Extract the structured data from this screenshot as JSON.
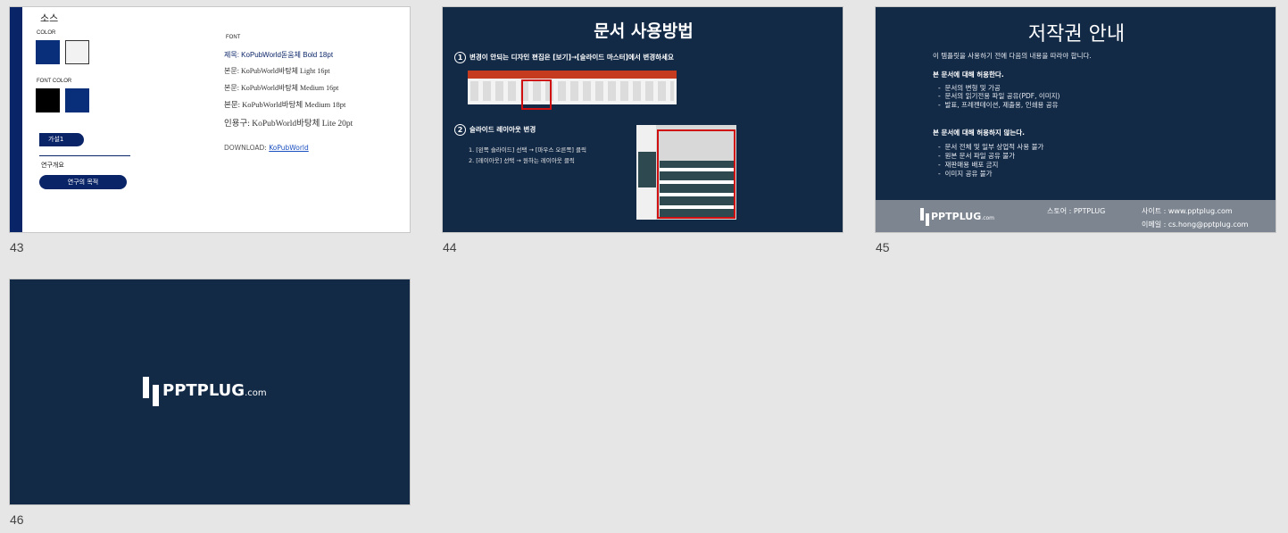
{
  "slides": [
    {
      "number": "43",
      "title": "소스",
      "color_label": "COLOR",
      "font_color_label": "FONT COLOR",
      "font_label": "FONT",
      "swatches": {
        "navy": "#0a2f7a",
        "light": "#f2f2f2",
        "black": "#000000"
      },
      "font_lines": [
        "제목: KoPubWorld돋움체 Bold 18pt",
        "본문: KoPubWorld바탕체 Light 16pt",
        "본문: KoPubWorld바탕체 Medium 16pt",
        "본문: KoPubWorld바탕체 Medium 18pt",
        "인용구: KoPubWorld바탕체 Lite 20pt"
      ],
      "download_label": "DOWNLOAD:",
      "download_link": "KoPubWorld",
      "pill_hypothesis": "가설1",
      "research_overview": "연구개요",
      "research_purpose": "연구의 목적"
    },
    {
      "number": "44",
      "title": "문서 사용방법",
      "step1_num": "1",
      "step1": "변경이 안되는 디자인 편집은 [보기]→[슬라이드 마스터]에서 변경하세요",
      "step2_num": "2",
      "step2": "슬라이드 레이아웃 변경",
      "sub1": "1. [왼쪽 슬라이드] 선택 → [마우스 오른쪽] 클릭",
      "sub2": "2. [레이아웃] 선택 → 원하는 레이아웃 클릭"
    },
    {
      "number": "45",
      "title": "저작권 안내",
      "intro": "이 템플릿을 사용하기 전에 다음의 내용을 따라야 합니다.",
      "allowed_heading": "본 문서에 대해 허용한다.",
      "allowed": [
        "문서의 변형 및 가공",
        "문서의 읽기전용 파일 공유(PDF, 이미지)",
        "발표, 프레젠테이션, 제출용, 인쇄용 공유"
      ],
      "denied_heading": "본 문서에 대해 허용하지 않는다.",
      "denied": [
        "문서 전체 및 일부 상업적 사용 불가",
        "원본 문서 파일 공유 불가",
        "재판매용 배포 금지",
        "이미지 공유 불가"
      ],
      "store": "스토어 : PPTPLUG",
      "site": "사이트 : www.pptplug.com",
      "email": "이메일 :  cs.hong@pptplug.com",
      "logo_text": "PPTPLUG",
      "logo_suffix": ".com"
    },
    {
      "number": "46",
      "logo_text": "PPTPLUG",
      "logo_suffix": ".com"
    }
  ],
  "colors": {
    "background": "#e6e6e6",
    "slide_navy": "#132a47",
    "accent_navy": "#0a2468",
    "ribbon_red": "#c43b1f",
    "highlight_red": "#d01010"
  }
}
